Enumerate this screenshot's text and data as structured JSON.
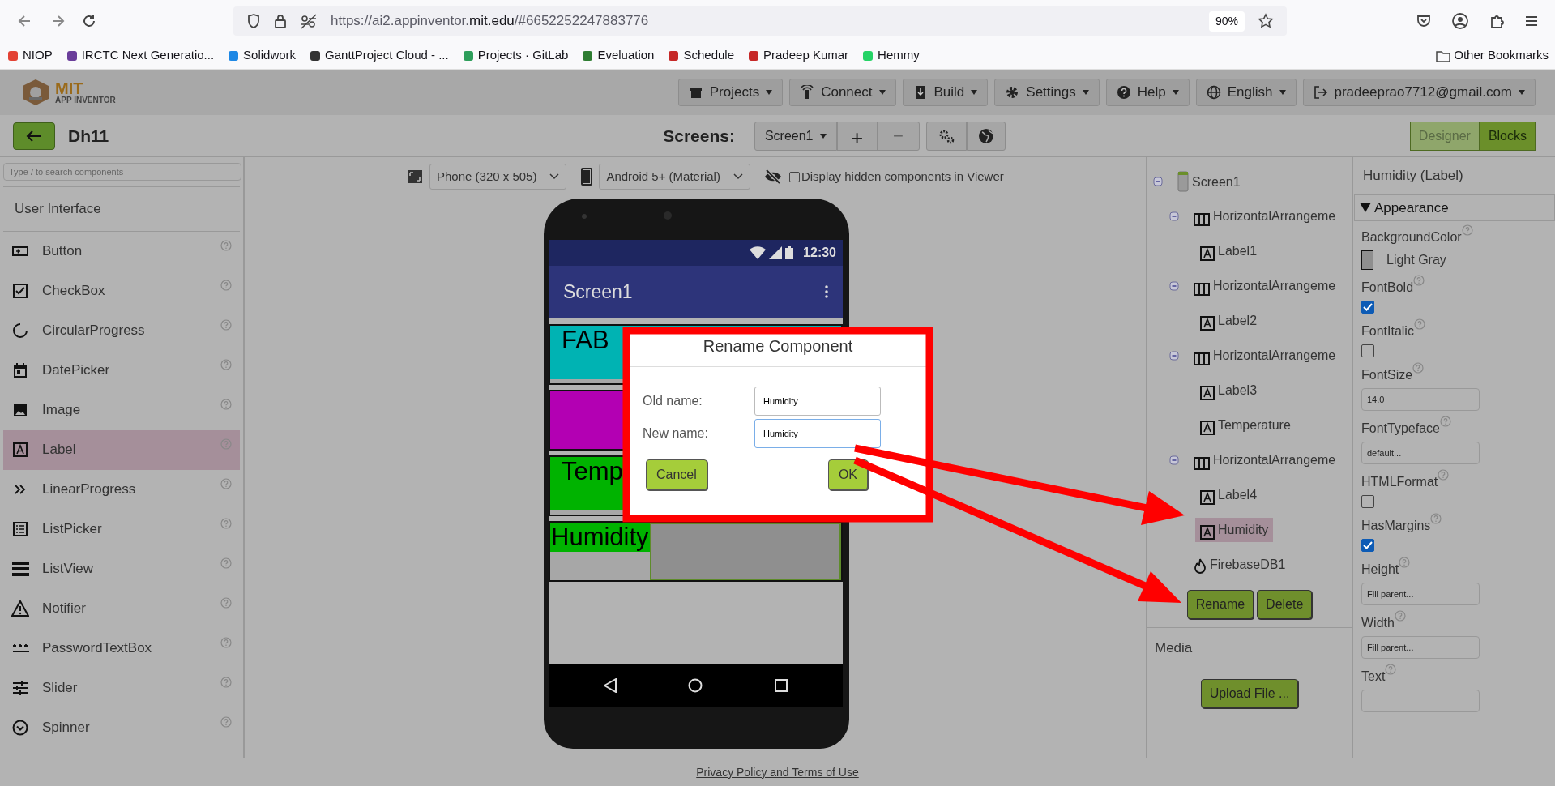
{
  "browser": {
    "url_prefix": "https://ai2.appinventor.",
    "url_domain": "mit.edu",
    "url_path": "/#6652252247883776",
    "zoom": "90%"
  },
  "bookmarks": [
    {
      "label": "NIOP"
    },
    {
      "label": "IRCTC Next Generatio..."
    },
    {
      "label": "Solidwork"
    },
    {
      "label": "GanttProject Cloud - ..."
    },
    {
      "label": "Projects · GitLab"
    },
    {
      "label": "Eveluation"
    },
    {
      "label": "Schedule"
    },
    {
      "label": "Pradeep Kumar"
    },
    {
      "label": "Hemmy"
    }
  ],
  "other_bookmarks": "Other Bookmarks",
  "app": {
    "logo_title": "MIT",
    "logo_subtitle": "APP INVENTOR",
    "menus": [
      "Projects",
      "Connect",
      "Build",
      "Settings",
      "Help",
      "English",
      "pradeeprao7712@gmail.com"
    ],
    "project_name": "Dh11",
    "screens_label": "Screens:",
    "screen_select": "Screen1",
    "add": "+",
    "remove": "−",
    "view_tabs": [
      {
        "label": "Designer",
        "selected": true
      },
      {
        "label": "Blocks",
        "selected": false
      }
    ]
  },
  "palette": {
    "search_placeholder": "Type / to search components",
    "category": "User Interface",
    "items": [
      {
        "label": "Button",
        "selected": false
      },
      {
        "label": "CheckBox",
        "selected": false
      },
      {
        "label": "CircularProgress",
        "selected": false
      },
      {
        "label": "DatePicker",
        "selected": false
      },
      {
        "label": "Image",
        "selected": false
      },
      {
        "label": "Label",
        "selected": true
      },
      {
        "label": "LinearProgress",
        "selected": false
      },
      {
        "label": "ListPicker",
        "selected": false
      },
      {
        "label": "ListView",
        "selected": false
      },
      {
        "label": "Notifier",
        "selected": false
      },
      {
        "label": "PasswordTextBox",
        "selected": false
      },
      {
        "label": "Slider",
        "selected": false
      },
      {
        "label": "Spinner",
        "selected": false
      }
    ]
  },
  "viewer": {
    "size_select": "Phone (320 x 505)",
    "theme_select": "Android 5+ (Material)",
    "hidden_label": "Display hidden components in Viewer",
    "hidden_checked": false,
    "phone": {
      "time": "12:30",
      "title": "Screen1",
      "rows": [
        {
          "cells": [
            {
              "text": "FAB",
              "color": "#00b3b3",
              "selected": false
            }
          ]
        },
        {
          "cells": [
            {
              "color": "#b300b3",
              "selected": false
            }
          ]
        },
        {
          "cells": [
            {
              "text": "Temp",
              "color": "#00b300",
              "selected": false
            }
          ]
        },
        {
          "cells": [
            {
              "text": "Humidity",
              "color": "#00b300",
              "selected": false
            },
            {
              "color": "#8f8f8f",
              "selected": true
            }
          ]
        }
      ]
    }
  },
  "dialog": {
    "title": "Rename Component",
    "old_label": "Old name:",
    "old_value": "Humidity",
    "new_label": "New name:",
    "new_value": "Humidity",
    "buttons": [
      "Cancel",
      "OK"
    ]
  },
  "tree": [
    {
      "label": "Screen1",
      "kind": "screen",
      "expanded": true,
      "selected": false,
      "children": [
        {
          "label": "HorizontalArrangeme",
          "kind": "arrangement",
          "expanded": true,
          "selected": false,
          "children": [
            {
              "label": "Label1",
              "kind": "label",
              "selected": false
            }
          ]
        },
        {
          "label": "HorizontalArrangeme",
          "kind": "arrangement",
          "expanded": true,
          "selected": false,
          "children": [
            {
              "label": "Label2",
              "kind": "label",
              "selected": false
            }
          ]
        },
        {
          "label": "HorizontalArrangeme",
          "kind": "arrangement",
          "expanded": true,
          "selected": false,
          "children": [
            {
              "label": "Label3",
              "kind": "label",
              "selected": false
            },
            {
              "label": "Temperature",
              "kind": "label",
              "selected": false
            }
          ]
        },
        {
          "label": "HorizontalArrangeme",
          "kind": "arrangement",
          "expanded": true,
          "selected": false,
          "children": [
            {
              "label": "Label4",
              "kind": "label",
              "selected": false
            },
            {
              "label": "Humidity",
              "kind": "label",
              "selected": true
            }
          ]
        },
        {
          "label": "FirebaseDB1",
          "kind": "firebase",
          "selected": false
        }
      ]
    }
  ],
  "tree_buttons": [
    "Rename",
    "Delete"
  ],
  "media": "Media",
  "upload": "Upload File ...",
  "properties": {
    "title": "Humidity (Label)",
    "section": "Appearance",
    "section_expanded": true,
    "items": [
      {
        "kind": "color",
        "label": "BackgroundColor",
        "value": "Light Gray",
        "color": "#8f8f8f"
      },
      {
        "kind": "checkbox",
        "label": "FontBold",
        "checked": true
      },
      {
        "kind": "checkbox",
        "label": "FontItalic",
        "checked": false
      },
      {
        "kind": "text",
        "label": "FontSize",
        "value": "14.0"
      },
      {
        "kind": "text",
        "label": "FontTypeface",
        "value": "default..."
      },
      {
        "kind": "checkbox",
        "label": "HTMLFormat",
        "checked": false
      },
      {
        "kind": "checkbox",
        "label": "HasMargins",
        "checked": true
      },
      {
        "kind": "text",
        "label": "Height",
        "value": "Fill parent..."
      },
      {
        "kind": "text",
        "label": "Width",
        "value": "Fill parent..."
      },
      {
        "kind": "text",
        "label": "Text"
      }
    ]
  },
  "footer": "Privacy Policy and Terms of Use"
}
